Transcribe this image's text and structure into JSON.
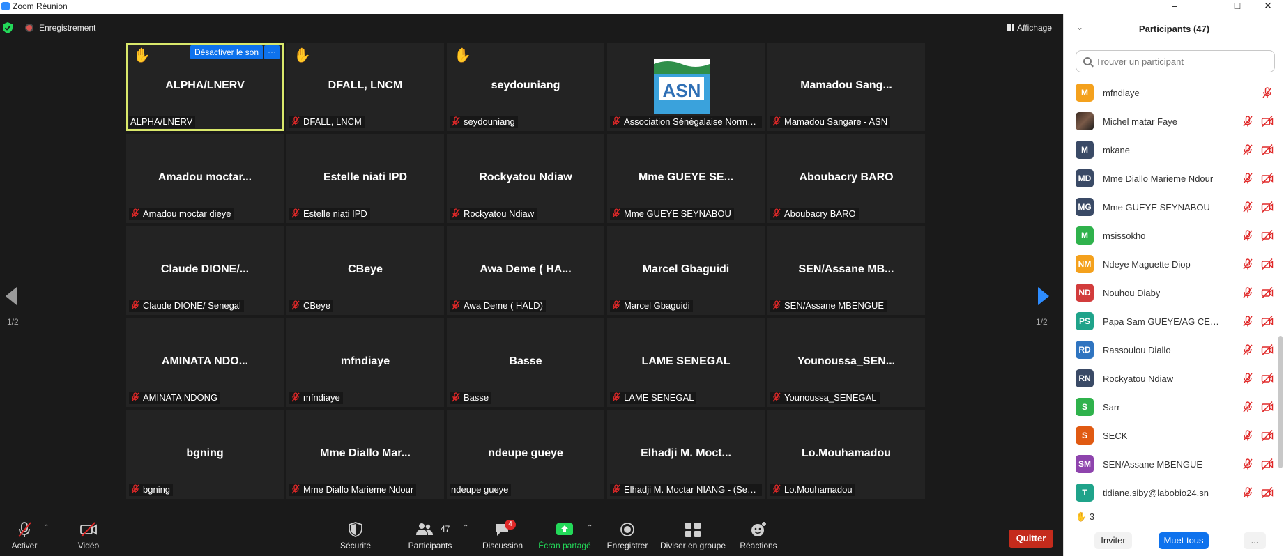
{
  "window": {
    "title": "Zoom Réunion"
  },
  "topbar": {
    "recording_label": "Enregistrement",
    "view_label": "Affichage"
  },
  "nav": {
    "page_left": "1/2",
    "page_right": "1/2"
  },
  "active_tile": {
    "unmute_label": "Désactiver le son",
    "more_label": "···"
  },
  "tiles": [
    {
      "name": "ALPHA/LNERV",
      "label": "ALPHA/LNERV",
      "muted": false,
      "hand": true,
      "active": true
    },
    {
      "name": "DFALL, LNCM",
      "label": "DFALL, LNCM",
      "muted": true,
      "hand": true
    },
    {
      "name": "seydouniang",
      "label": "seydouniang",
      "muted": true,
      "hand": true
    },
    {
      "name": "",
      "label": "Association Sénégalaise Normali...",
      "muted": true,
      "logo": true
    },
    {
      "name": "Mamadou  Sang...",
      "label": "Mamadou Sangare -  ASN",
      "muted": true
    },
    {
      "name": "Amadou  moctar...",
      "label": "Amadou moctar dieye",
      "muted": true
    },
    {
      "name": "Estelle niati IPD",
      "label": "Estelle niati IPD",
      "muted": true
    },
    {
      "name": "Rockyatou Ndiaw",
      "label": "Rockyatou Ndiaw",
      "muted": true
    },
    {
      "name": "Mme GUEYE SE...",
      "label": "Mme GUEYE SEYNABOU",
      "muted": true
    },
    {
      "name": "Aboubacry BARO",
      "label": "Aboubacry BARO",
      "muted": true
    },
    {
      "name": "Claude  DIONE/...",
      "label": "Claude DIONE/ Senegal",
      "muted": true
    },
    {
      "name": "CBeye",
      "label": "CBeye",
      "muted": true
    },
    {
      "name": "Awa Deme ( HA...",
      "label": "Awa Deme ( HALD)",
      "muted": true
    },
    {
      "name": "Marcel Gbaguidi",
      "label": "Marcel Gbaguidi",
      "muted": true
    },
    {
      "name": "SEN/Assane MB...",
      "label": "SEN/Assane MBENGUE",
      "muted": true
    },
    {
      "name": "AMINATA  NDO...",
      "label": "AMINATA NDONG",
      "muted": true
    },
    {
      "name": "mfndiaye",
      "label": "mfndiaye",
      "muted": true
    },
    {
      "name": "Basse",
      "label": "Basse",
      "muted": true
    },
    {
      "name": "LAME SENEGAL",
      "label": "LAME SENEGAL",
      "muted": true
    },
    {
      "name": "Younoussa_SEN...",
      "label": "Younoussa_SENEGAL",
      "muted": true
    },
    {
      "name": "bgning",
      "label": "bgning",
      "muted": true
    },
    {
      "name": "Mme  Diallo  Mar...",
      "label": "Mme Diallo Marieme Ndour",
      "muted": true
    },
    {
      "name": "ndeupe gueye",
      "label": "ndeupe gueye",
      "muted": false
    },
    {
      "name": "Elhadji  M.  Moct...",
      "label": "Elhadji M. Moctar NIANG - (Sen...",
      "muted": true
    },
    {
      "name": "Lo.Mouhamadou",
      "label": "Lo.Mouhamadou",
      "muted": true
    }
  ],
  "toolbar": {
    "mute_label": "Activer",
    "video_label": "Vidéo",
    "security_label": "Sécurité",
    "participants_label": "Participants",
    "participants_count": "47",
    "chat_label": "Discussion",
    "chat_badge": "4",
    "share_label": "Écran partagé",
    "record_label": "Enregistrer",
    "breakout_label": "Diviser en groupe",
    "reactions_label": "Réactions",
    "quit_label": "Quitter",
    "colors": {
      "share": "#23d959",
      "badge": "#e02828",
      "quit": "#c42b1c"
    }
  },
  "panel": {
    "title": "Participants (47)",
    "search_placeholder": "Trouver un participant",
    "participants": [
      {
        "initials": "M",
        "name": "mfndiaye",
        "color": "#f4a11d",
        "video_off": false
      },
      {
        "initials": "",
        "name": "Michel matar Faye",
        "color": "photo",
        "video_off": true
      },
      {
        "initials": "M",
        "name": "mkane",
        "color": "#3a4a66",
        "video_off": true
      },
      {
        "initials": "MD",
        "name": "Mme Diallo Marieme Ndour",
        "color": "#3a4a66",
        "video_off": true
      },
      {
        "initials": "MG",
        "name": "Mme GUEYE SEYNABOU",
        "color": "#3a4a66",
        "video_off": true
      },
      {
        "initials": "M",
        "name": "msissokho",
        "color": "#2fb24c",
        "video_off": true
      },
      {
        "initials": "NM",
        "name": "Ndeye Maguette Diop",
        "color": "#f4a11d",
        "video_off": true
      },
      {
        "initials": "ND",
        "name": "Nouhou Diaby",
        "color": "#d23c3c",
        "video_off": true
      },
      {
        "initials": "PS",
        "name": "Papa Sam GUEYE/AG CERES-Lo...",
        "color": "#1fa38a",
        "video_off": true
      },
      {
        "initials": "RD",
        "name": "Rassoulou Diallo",
        "color": "#2f74c0",
        "video_off": true
      },
      {
        "initials": "RN",
        "name": "Rockyatou Ndiaw",
        "color": "#3a4a66",
        "video_off": true
      },
      {
        "initials": "S",
        "name": "Sarr",
        "color": "#2fb24c",
        "video_off": true
      },
      {
        "initials": "S",
        "name": "SECK",
        "color": "#e05a12",
        "video_off": true
      },
      {
        "initials": "SM",
        "name": "SEN/Assane MBENGUE",
        "color": "#8e44ad",
        "video_off": true
      },
      {
        "initials": "T",
        "name": "tidiane.siby@labobio24.sn",
        "color": "#1fa38a",
        "video_off": true
      }
    ],
    "hand_count": "3",
    "invite_label": "Inviter",
    "mute_all_label": "Muet tous",
    "more_label": "..."
  }
}
